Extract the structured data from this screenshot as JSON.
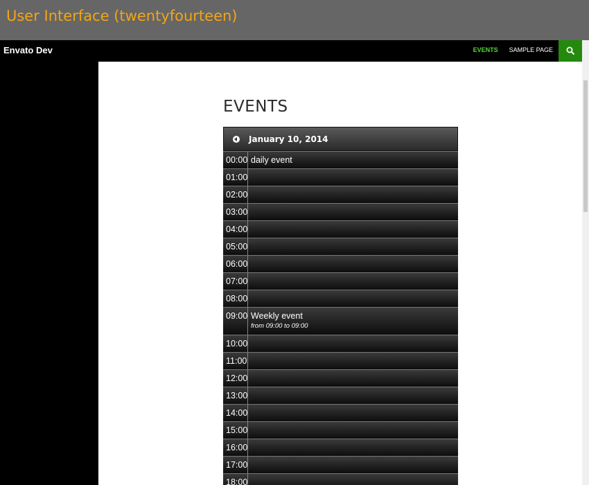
{
  "window": {
    "title": "User Interface (twentyfourteen)"
  },
  "site": {
    "title": "Envato Dev"
  },
  "nav": {
    "items": [
      {
        "label": "EVENTS",
        "active": true
      },
      {
        "label": "SAMPLE PAGE",
        "active": false
      }
    ],
    "search_icon": "search-icon"
  },
  "colors": {
    "title_text": "#f2a516",
    "active_nav": "#55d737",
    "search_bg": "#24890d"
  },
  "page": {
    "heading": "EVENTS"
  },
  "calendar": {
    "date": "January 10, 2014",
    "prev_icon": "chevron-left-circle-icon",
    "rows": [
      {
        "time": "00:00",
        "event": "daily event",
        "detail": ""
      },
      {
        "time": "01:00",
        "event": "",
        "detail": ""
      },
      {
        "time": "02:00",
        "event": "",
        "detail": ""
      },
      {
        "time": "03:00",
        "event": "",
        "detail": ""
      },
      {
        "time": "04:00",
        "event": "",
        "detail": ""
      },
      {
        "time": "05:00",
        "event": "",
        "detail": ""
      },
      {
        "time": "06:00",
        "event": "",
        "detail": ""
      },
      {
        "time": "07:00",
        "event": "",
        "detail": ""
      },
      {
        "time": "08:00",
        "event": "",
        "detail": ""
      },
      {
        "time": "09:00",
        "event": "Weekly event",
        "detail": "from 09:00 to 09:00"
      },
      {
        "time": "10:00",
        "event": "",
        "detail": ""
      },
      {
        "time": "11:00",
        "event": "",
        "detail": ""
      },
      {
        "time": "12:00",
        "event": "",
        "detail": ""
      },
      {
        "time": "13:00",
        "event": "",
        "detail": ""
      },
      {
        "time": "14:00",
        "event": "",
        "detail": ""
      },
      {
        "time": "15:00",
        "event": "",
        "detail": ""
      },
      {
        "time": "16:00",
        "event": "",
        "detail": ""
      },
      {
        "time": "17:00",
        "event": "",
        "detail": ""
      },
      {
        "time": "18:00",
        "event": "",
        "detail": ""
      }
    ]
  }
}
